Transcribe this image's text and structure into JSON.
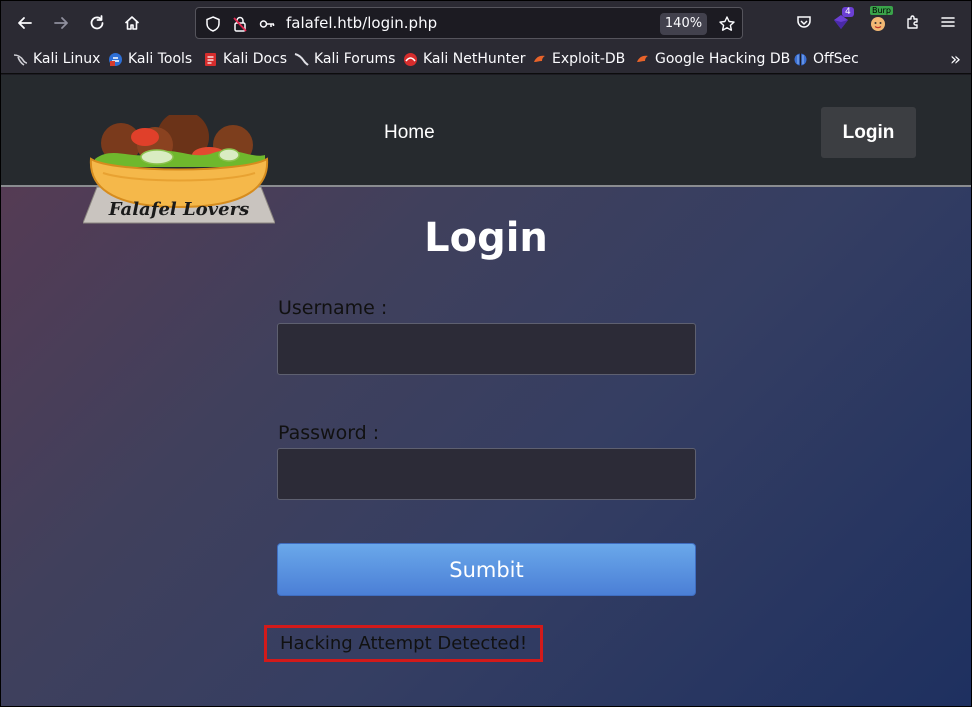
{
  "browser": {
    "url": "falafel.htb/login.php",
    "zoom": "140%",
    "extension_badge": "4",
    "burp_label": "Burp",
    "bookmarks": [
      {
        "label": "Kali Linux",
        "icon": "kali-dragon-icon"
      },
      {
        "label": "Kali Tools",
        "icon": "kali-tools-icon"
      },
      {
        "label": "Kali Docs",
        "icon": "kali-docs-icon"
      },
      {
        "label": "Kali Forums",
        "icon": "kali-forums-icon"
      },
      {
        "label": "Kali NetHunter",
        "icon": "nethunter-icon"
      },
      {
        "label": "Exploit-DB",
        "icon": "exploit-db-icon"
      },
      {
        "label": "Google Hacking DB",
        "icon": "ghdb-icon"
      },
      {
        "label": "OffSec",
        "icon": "offsec-icon"
      }
    ]
  },
  "site": {
    "logo_text": "Falafel Lovers",
    "nav": {
      "home": "Home",
      "login": "Login"
    },
    "title": "Login",
    "form": {
      "username_label": "Username :",
      "username_value": "",
      "password_label": "Password :",
      "password_value": "",
      "submit_label": "Sumbit"
    },
    "error": "Hacking Attempt Detected!"
  },
  "colors": {
    "header_bg": "#262a2e",
    "submit_bg": "#5a92e0",
    "error_border": "#d21a1a"
  }
}
